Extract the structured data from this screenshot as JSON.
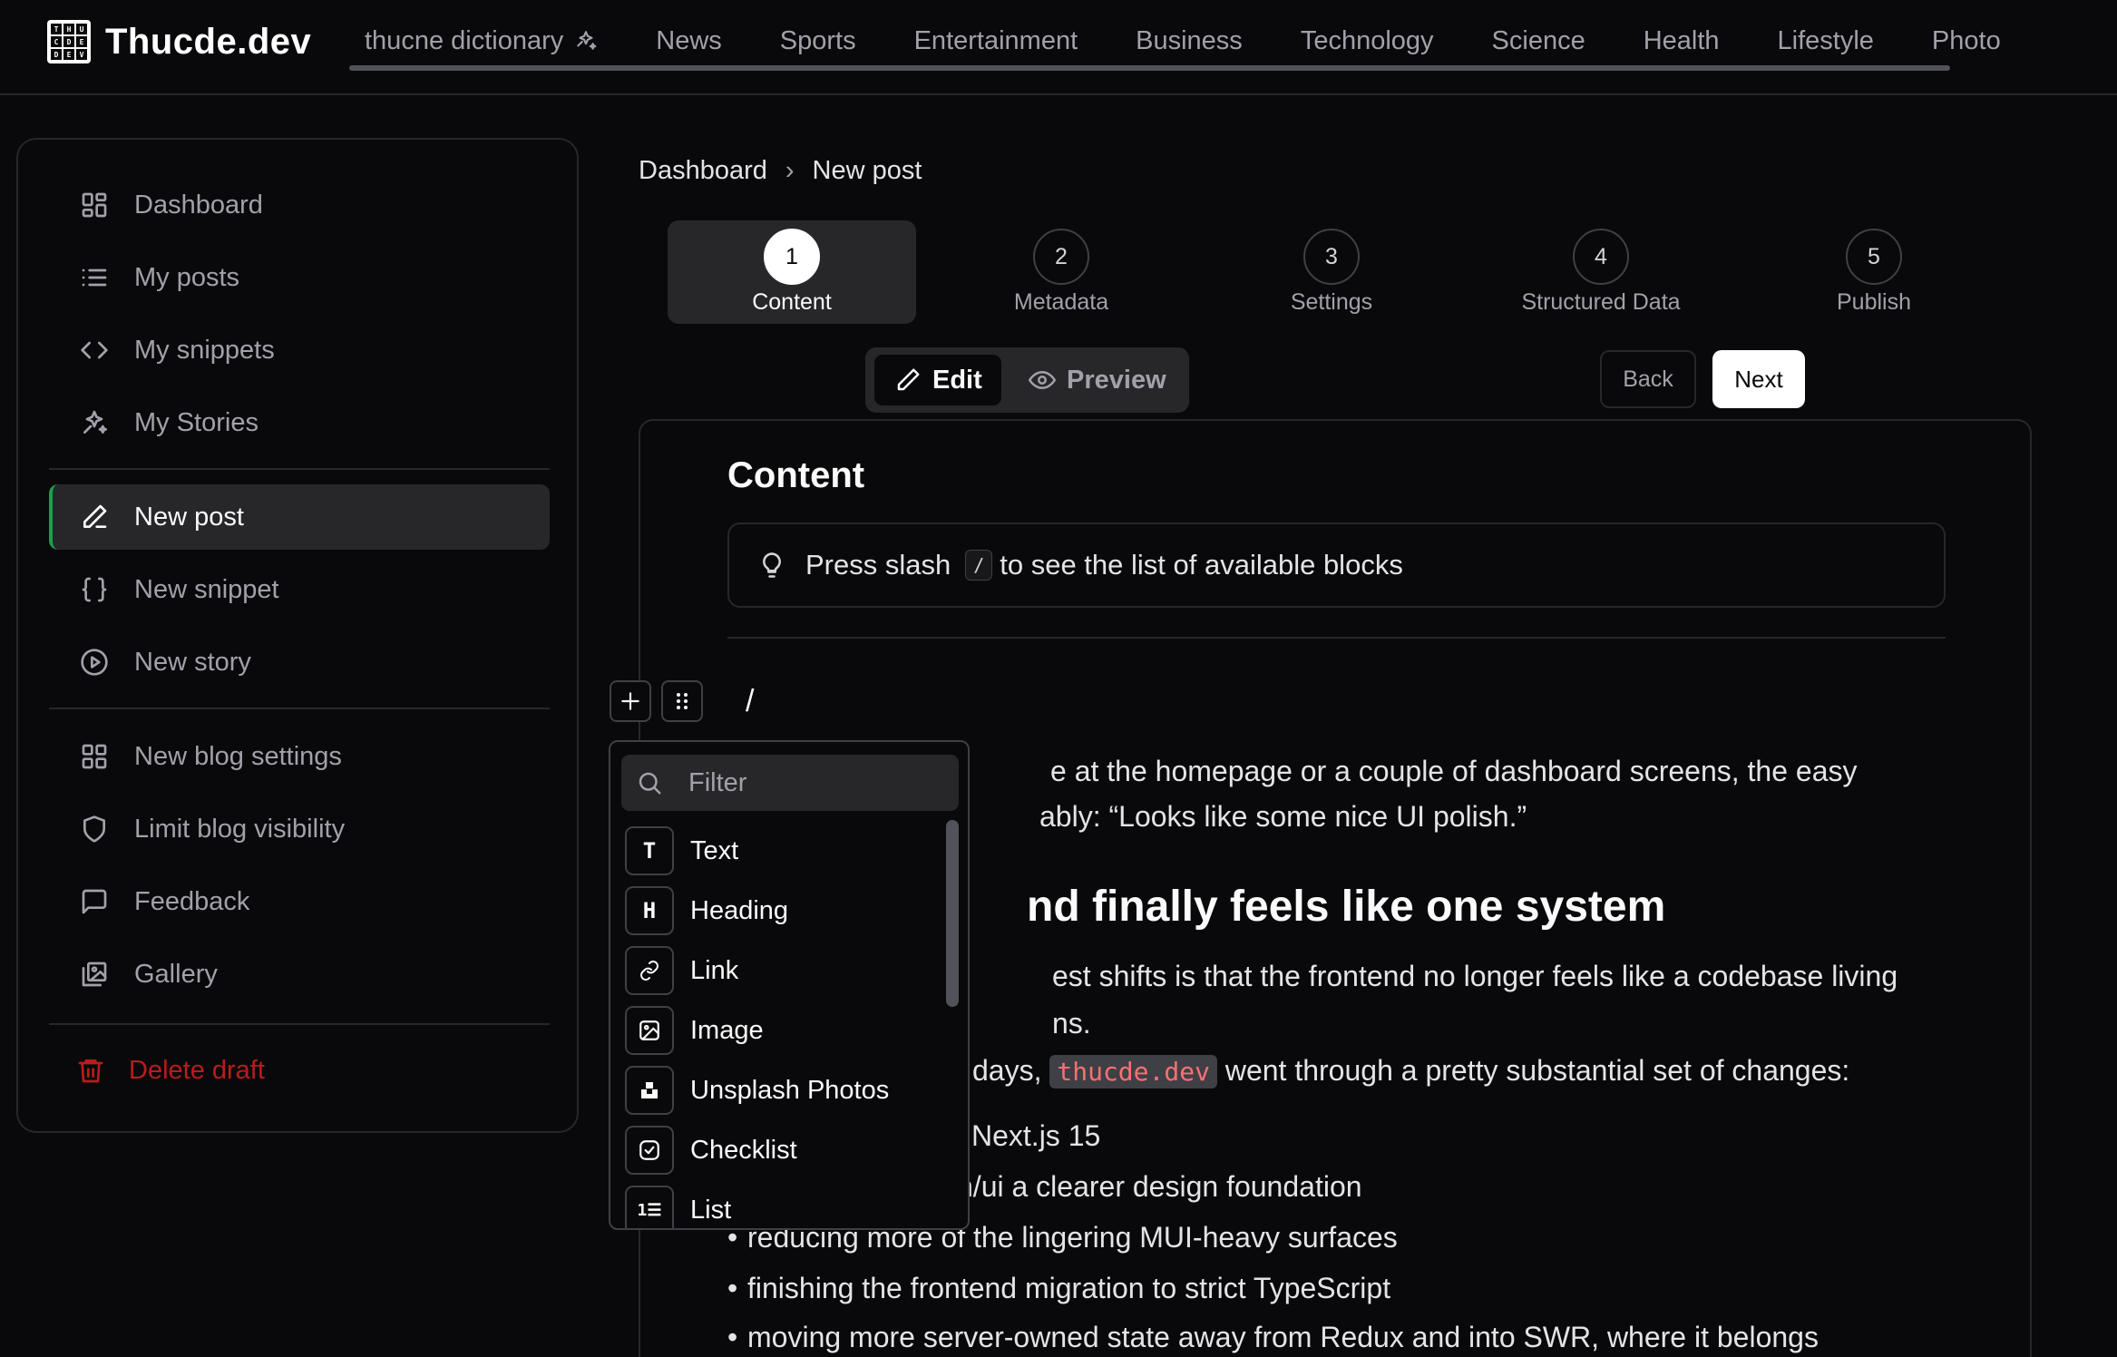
{
  "brand": {
    "logo_letters": [
      "T",
      "H",
      "U",
      "C",
      "D",
      "E",
      "D",
      "E",
      "V"
    ],
    "name": "Thucde.dev"
  },
  "nav": {
    "items": [
      "thucne dictionary",
      "News",
      "Sports",
      "Entertainment",
      "Business",
      "Technology",
      "Science",
      "Health",
      "Lifestyle",
      "Photo"
    ]
  },
  "sidebar": {
    "items": [
      {
        "label": "Dashboard",
        "icon": "dashboard-icon"
      },
      {
        "label": "My posts",
        "icon": "list-icon"
      },
      {
        "label": "My snippets",
        "icon": "code-icon"
      },
      {
        "label": "My Stories",
        "icon": "sparkles-icon"
      },
      {
        "label": "New post",
        "icon": "pen-icon",
        "active": true
      },
      {
        "label": "New snippet",
        "icon": "braces-icon"
      },
      {
        "label": "New story",
        "icon": "play-circle-icon"
      },
      {
        "label": "New blog settings",
        "icon": "grid-icon"
      },
      {
        "label": "Limit blog visibility",
        "icon": "shield-icon"
      },
      {
        "label": "Feedback",
        "icon": "message-icon"
      },
      {
        "label": "Gallery",
        "icon": "gallery-icon"
      },
      {
        "label": "Delete draft",
        "icon": "trash-icon"
      }
    ]
  },
  "breadcrumb": {
    "root": "Dashboard",
    "separator": "›",
    "current": "New post"
  },
  "steps": [
    {
      "num": "1",
      "label": "Content"
    },
    {
      "num": "2",
      "label": "Metadata"
    },
    {
      "num": "3",
      "label": "Settings"
    },
    {
      "num": "4",
      "label": "Structured Data"
    },
    {
      "num": "5",
      "label": "Publish"
    }
  ],
  "mode_toggle": {
    "edit": "Edit",
    "preview": "Preview"
  },
  "actions": {
    "back": "Back",
    "next": "Next"
  },
  "editor": {
    "title": "Content",
    "tip_before": "Press slash",
    "tip_key": "/",
    "tip_after": "to see the list of available blocks",
    "slash": "/",
    "para1_line1": "e at the homepage or a couple of dashboard screens, the easy",
    "para1_line2": "ably: “Looks like some nice UI polish.”",
    "heading": "nd finally feels like one system",
    "para2_line1": "est shifts is that the frontend no longer feels like a codebase living",
    "para2_line2": "ns.",
    "para3_before": "days,",
    "para3_code": "thucde.dev",
    "para3_after": "went through a pretty substantial set of changes:",
    "bullets": [
      "Next.js 15",
      "n/ui a clearer design foundation",
      "reducing more of the lingering MUI-heavy surfaces",
      "finishing the frontend migration to strict TypeScript",
      "moving more server-owned state away from Redux and into SWR, where it belongs"
    ]
  },
  "block_menu": {
    "filter_placeholder": "Filter",
    "items": [
      {
        "label": "Text",
        "glyph": "T"
      },
      {
        "label": "Heading",
        "glyph": "H"
      },
      {
        "label": "Link",
        "glyph": ""
      },
      {
        "label": "Image",
        "glyph": ""
      },
      {
        "label": "Unsplash Photos",
        "glyph": ""
      },
      {
        "label": "Checklist",
        "glyph": ""
      },
      {
        "label": "List",
        "glyph": "1☰"
      }
    ]
  },
  "colors": {
    "accent": "#16a34a",
    "danger": "#b91c1c",
    "background": "#09090b",
    "code_text": "#f87171"
  }
}
